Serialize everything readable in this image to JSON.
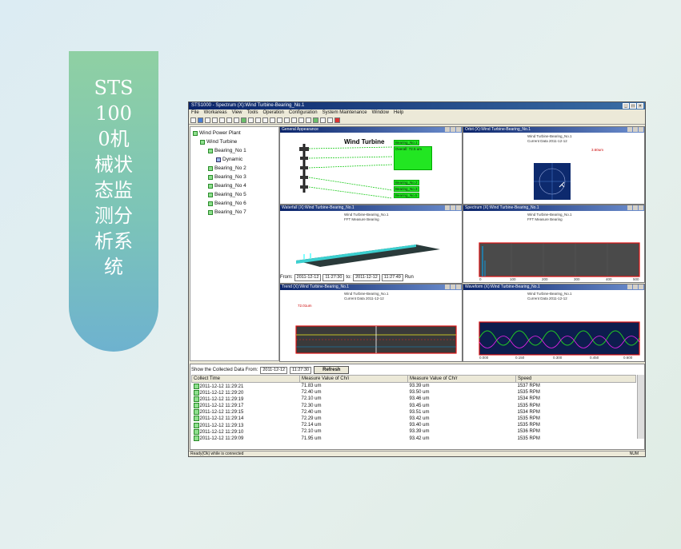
{
  "banner": {
    "title": "STS 1000机械状态监测分析系统"
  },
  "window": {
    "title": "STS1000 - Spectrum (X):Wind Turbine-Bearing_No.1",
    "menu": [
      "File",
      "Workareas",
      "View",
      "Tools",
      "Operation",
      "Configuration",
      "System Maintenance",
      "Window",
      "Help"
    ],
    "status_left": "Ready(Ok) while is connected",
    "status_right": "NUM"
  },
  "tree": {
    "root": "Wind Power Plant",
    "child": "Wind Turbine",
    "items": [
      "Bearing_No 1",
      "Dynamic",
      "Bearing_No 2",
      "Bearing_No 3",
      "Bearing_No 4",
      "Bearing_No 5",
      "Bearing_No 6",
      "Bearing_No 7"
    ]
  },
  "panes": {
    "general": {
      "title": "General Appearance",
      "label": "Wind Turbine",
      "tags": [
        "Bearing_No.1",
        "Overall: 72.5 um",
        "Bearing_No.2",
        "Bearing_No.3",
        "Bearing_No.5"
      ]
    },
    "orbit": {
      "title": "Orbit (X):Wind Turbine-Bearing_No.1",
      "sub1": "Wind Turbine-Bearing_No.1",
      "sub2": "Current Data 2011-12-12",
      "val": "3.60um"
    },
    "waterfall": {
      "title": "Waterfall (X):Wind Turbine-Bearing_No.1",
      "sub1": "Wind Turbine-Bearing_No.1",
      "sub2": "FFT Measure Bearing"
    },
    "spectrum": {
      "title": "Spectrum (X):Wind Turbine-Bearing_No.1",
      "sub1": "Wind Turbine-Bearing_No.1",
      "sub2": "FFT Measure Bearing",
      "ticks": [
        "0",
        "100",
        "200",
        "300",
        "400",
        "500"
      ]
    },
    "trend": {
      "title": "Trend (X):Wind Turbine-Bearing_No.1",
      "sub1": "Wind Turbine-Bearing_No.1",
      "sub2": "Current Data 2011-12-12",
      "val": "72.01um"
    },
    "waveform": {
      "title": "Waveform (X):Wind Turbine-Bearing_No.1",
      "sub1": "Wind Turbine-Bearing_No.1",
      "sub2": "Current Data 2011-12-12",
      "ticks": [
        "0.000",
        "0.150",
        "0.300",
        "0.450",
        "0.600"
      ]
    }
  },
  "date_range": {
    "from_label": "From:",
    "from_date": "2011-12-12",
    "from_time": "11:27:30",
    "to_label": "to:",
    "to_date": "2011-12-12",
    "to_time": "11:27:49",
    "btn": "Run"
  },
  "bottom": {
    "filter_label": "Show the Collected Data From:",
    "date": "2011-12-12",
    "time": "11:27:30",
    "refresh": "Refresh",
    "columns": [
      "Collect Time",
      "Measure Value of Ch/i",
      "Measure Value of Ch/r",
      "Speed"
    ],
    "rows": [
      [
        "2011-12-12 11:29:21",
        "71.83 um",
        "93.39 um",
        "1537 RPM"
      ],
      [
        "2011-12-12 11:29:20",
        "72.40 um",
        "93.50 um",
        "1535 RPM"
      ],
      [
        "2011-12-12 11:29:19",
        "72.10 um",
        "93.46 um",
        "1534 RPM"
      ],
      [
        "2011-12-12 11:29:17",
        "72.30 um",
        "93.45 um",
        "1535 RPM"
      ],
      [
        "2011-12-12 11:29:15",
        "72.40 um",
        "93.51 um",
        "1534 RPM"
      ],
      [
        "2011-12-12 11:29:14",
        "72.29 um",
        "93.42 um",
        "1535 RPM"
      ],
      [
        "2011-12-12 11:29:13",
        "72.14 um",
        "93.40 um",
        "1535 RPM"
      ],
      [
        "2011-12-12 11:29:10",
        "72.10 um",
        "93.39 um",
        "1536 RPM"
      ],
      [
        "2011-12-12 11:29:09",
        "71.95 um",
        "93.42 um",
        "1535 RPM"
      ]
    ]
  }
}
